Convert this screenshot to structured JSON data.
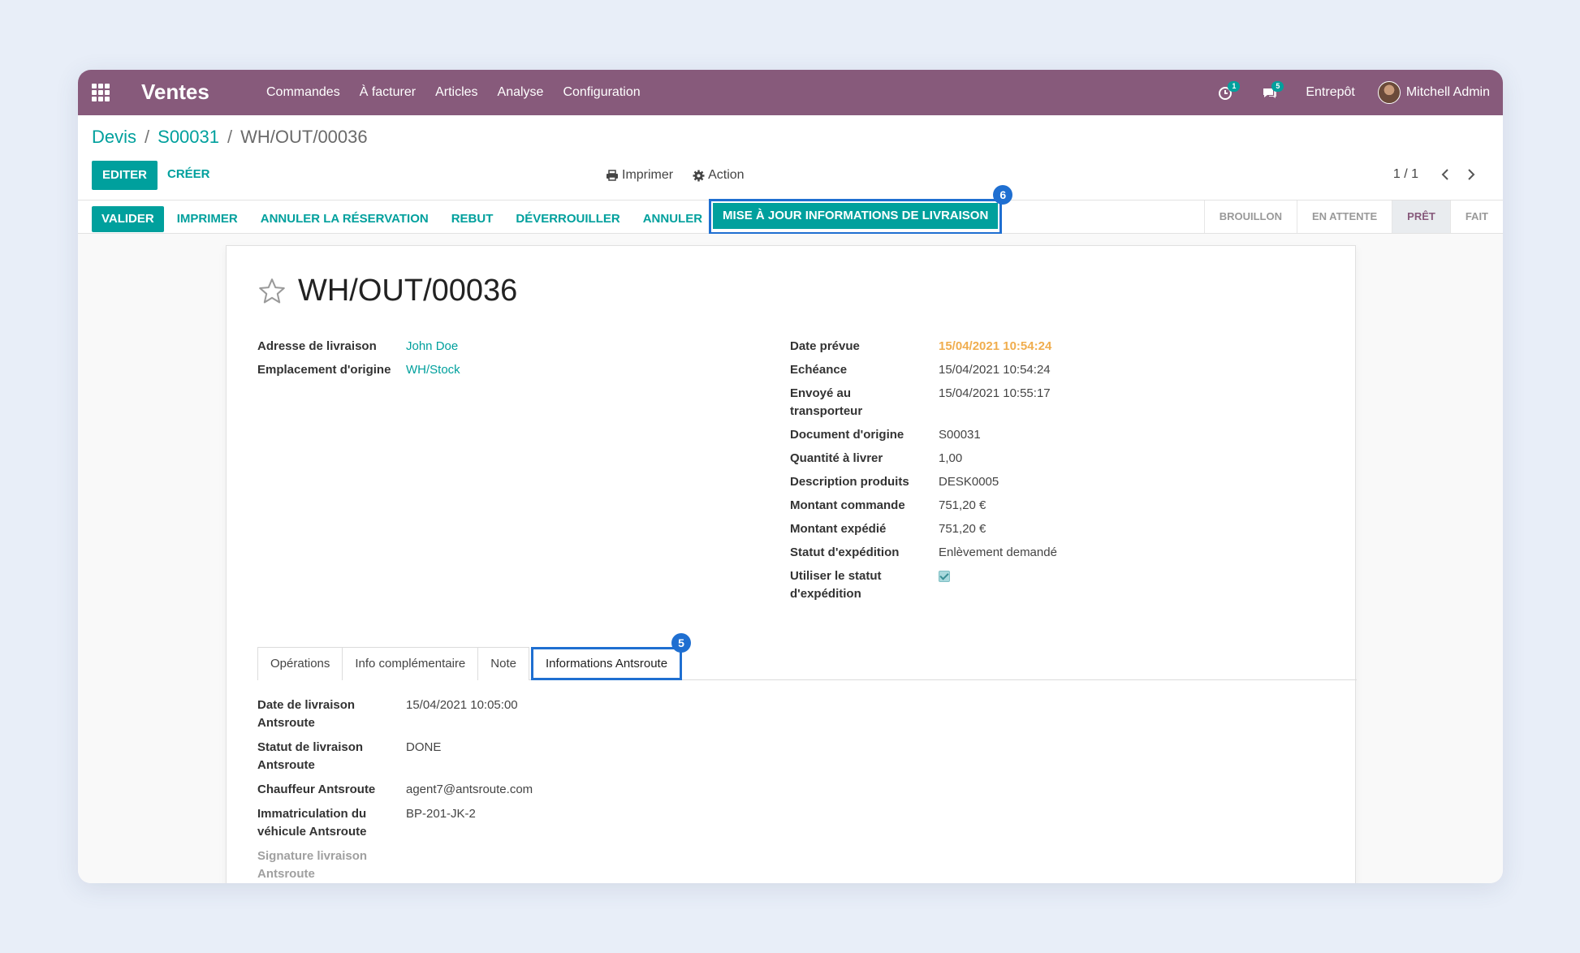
{
  "navbar": {
    "app_name": "Ventes",
    "menu": [
      "Commandes",
      "À facturer",
      "Articles",
      "Analyse",
      "Configuration"
    ],
    "activity_count": "1",
    "messages_count": "5",
    "warehouse": "Entrepôt",
    "user": "Mitchell Admin"
  },
  "breadcrumb": {
    "items": [
      "Devis",
      "S00031"
    ],
    "current": "WH/OUT/00036"
  },
  "control": {
    "edit_label": "EDITER",
    "create_label": "CRÉER",
    "print_label": "Imprimer",
    "action_label": "Action",
    "pager": "1 / 1"
  },
  "statusbar": {
    "buttons": [
      "VALIDER",
      "IMPRIMER",
      "ANNULER LA RÉSERVATION",
      "REBUT",
      "DÉVERROUILLER",
      "ANNULER"
    ],
    "highlight_button": "MISE À JOUR INFORMATIONS DE LIVRAISON",
    "highlight_marker": "6",
    "stages": [
      "BROUILLON",
      "EN ATTENTE",
      "PRÊT",
      "FAIT"
    ],
    "active_stage": "PRÊT"
  },
  "record": {
    "title": "WH/OUT/00036",
    "left_fields": [
      {
        "label": "Adresse de livraison",
        "value": "John Doe"
      },
      {
        "label": "Emplacement d'origine",
        "value": "WH/Stock"
      }
    ],
    "right_fields": [
      {
        "label": "Date prévue",
        "value": "15/04/2021 10:54:24"
      },
      {
        "label": "Echéance",
        "value": "15/04/2021 10:54:24"
      },
      {
        "label": "Envoyé au transporteur",
        "value": "15/04/2021 10:55:17"
      },
      {
        "label": "Document d'origine",
        "value": "S00031"
      },
      {
        "label": "Quantité à livrer",
        "value": "1,00"
      },
      {
        "label": "Description produits",
        "value": "DESK0005"
      },
      {
        "label": "Montant commande",
        "value": "751,20 €"
      },
      {
        "label": "Montant expédié",
        "value": "751,20 €"
      },
      {
        "label": "Statut d'expédition",
        "value": "Enlèvement demandé"
      },
      {
        "label": "Utiliser le statut d'expédition",
        "value": ""
      }
    ]
  },
  "tabs": {
    "items": [
      "Opérations",
      "Info complémentaire",
      "Note"
    ],
    "highlight_tab": "Informations Antsroute",
    "highlight_marker": "5"
  },
  "antsroute": {
    "fields": [
      {
        "label": "Date de livraison Antsroute",
        "value": "15/04/2021 10:05:00"
      },
      {
        "label": "Statut de livraison Antsroute",
        "value": "DONE"
      },
      {
        "label": "Chauffeur Antsroute",
        "value": "agent7@antsroute.com"
      },
      {
        "label": "Immatriculation du véhicule Antsroute",
        "value": "BP-201-JK-2"
      },
      {
        "label": "Signature livraison Antsroute",
        "value": ""
      }
    ]
  },
  "colors": {
    "navbar": "#875a7b",
    "primary": "#00a09d",
    "highlight": "#1f6fd1",
    "warning": "#f0ad4e"
  }
}
